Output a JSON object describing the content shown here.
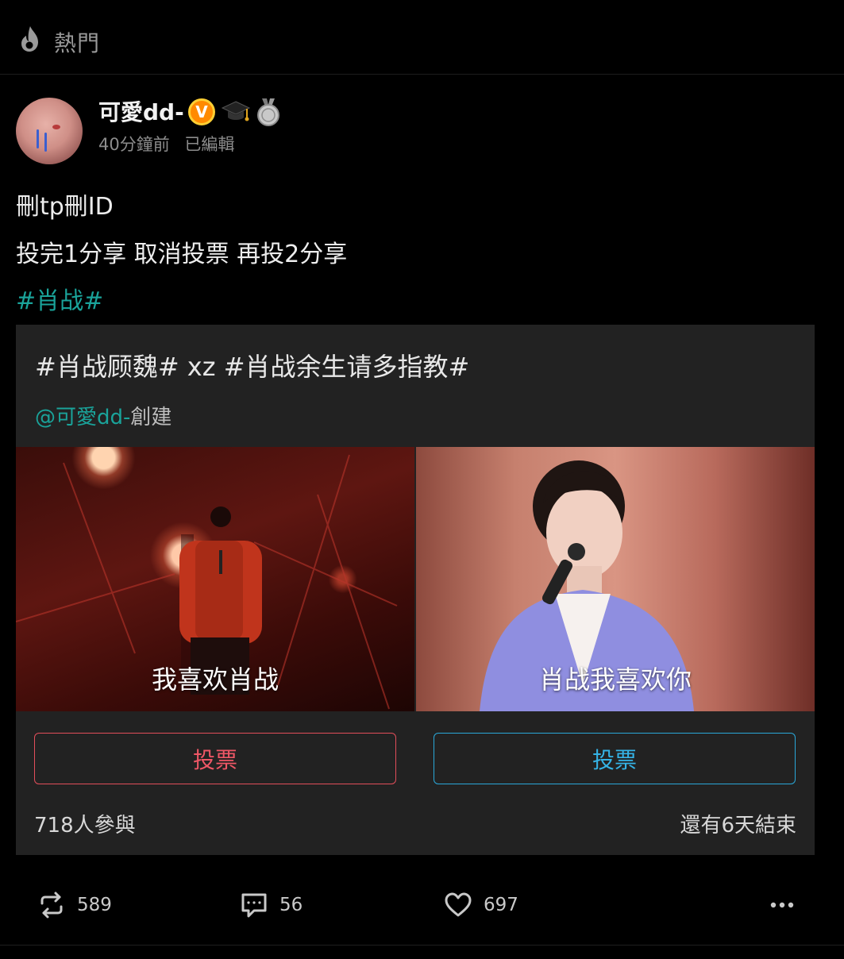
{
  "header": {
    "icon": "flame-icon",
    "label": "熱門"
  },
  "post": {
    "author": {
      "name": "可愛dd-",
      "verified_badge": "V",
      "badges": [
        "graduation-cap-icon",
        "medal-icon"
      ]
    },
    "time": "40分鐘前",
    "edited": "已編輯",
    "lines": [
      "刪tp刪ID",
      "投完1分享 取消投票 再投2分享"
    ],
    "hashtag": "#肖战#"
  },
  "vote": {
    "title": "#肖战顾魏# xz #肖战余生请多指教#",
    "creator_mention": "@可愛dd-",
    "creator_suffix": "創建",
    "options": [
      {
        "caption": "我喜欢肖战",
        "button": "投票",
        "color": "#ef5766"
      },
      {
        "caption": "肖战我喜欢你",
        "button": "投票",
        "color": "#35b3e6"
      }
    ],
    "participants": "718人參與",
    "time_left": "還有6天結束"
  },
  "actions": {
    "repost": {
      "icon": "repost-icon",
      "count": "589"
    },
    "comment": {
      "icon": "comment-icon",
      "count": "56"
    },
    "like": {
      "icon": "heart-icon",
      "count": "697"
    },
    "more": {
      "icon": "more-icon"
    }
  },
  "colors": {
    "background": "#000000",
    "card": "#222222",
    "accent_teal": "#1aa39a"
  }
}
